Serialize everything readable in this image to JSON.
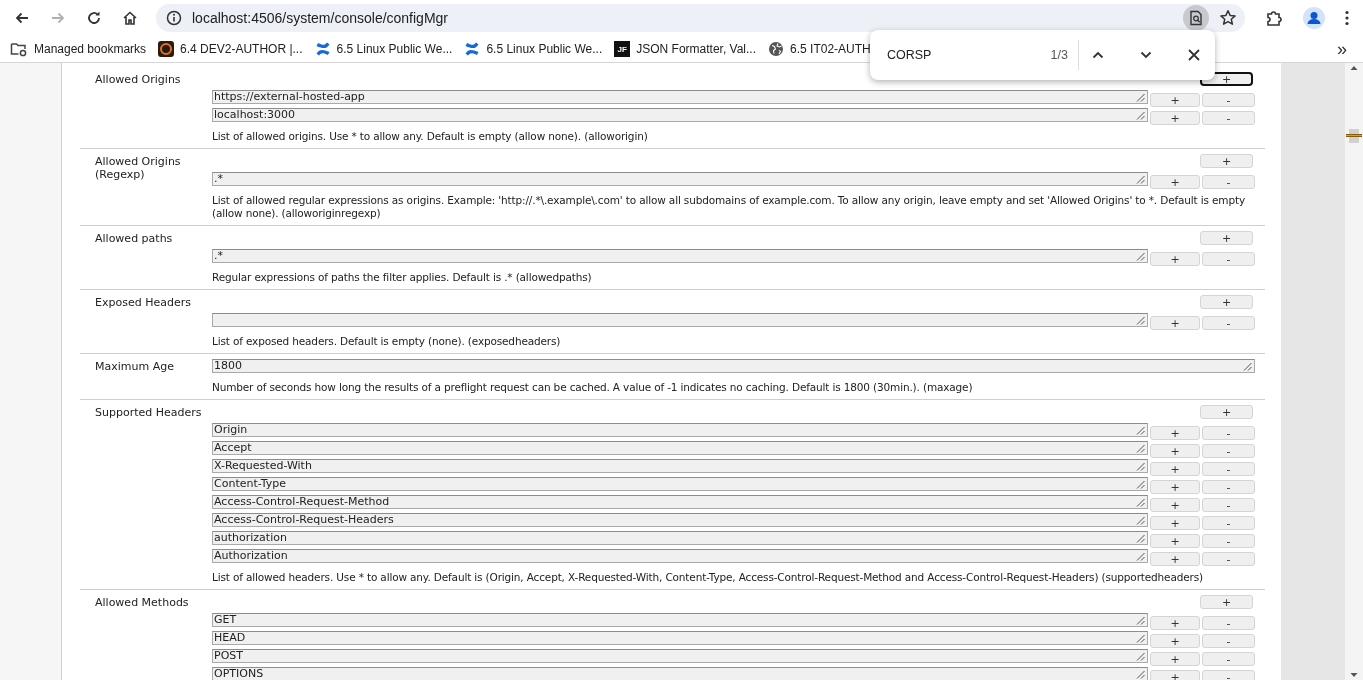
{
  "browser": {
    "forward_disabled": true,
    "address": "localhost:4506/system/console/configMgr",
    "find_active": true,
    "bookmarks": [
      {
        "kind": "folder",
        "label": "Managed bookmarks"
      },
      {
        "kind": "aem",
        "label": "6.4 DEV2-AUTHOR |..."
      },
      {
        "kind": "confluence",
        "label": "6.5 Linux Public We..."
      },
      {
        "kind": "confluence",
        "label": "6.5 Linux Public We..."
      },
      {
        "kind": "badge",
        "badge": "JF",
        "label": "JSON Formatter, Val..."
      },
      {
        "kind": "globe",
        "label": "6.5 IT02-AUTH"
      }
    ],
    "more": "»"
  },
  "find_bar": {
    "query": "CORSP",
    "count": "1/3"
  },
  "sections": [
    {
      "kind": "multi",
      "label": "Allowed Origins",
      "add": {
        "label": "+",
        "focused": true
      },
      "entries": [
        {
          "value": "https://external-hosted-app",
          "add": "+",
          "remove": "-"
        },
        {
          "value": "localhost:3000",
          "add": "+",
          "remove": "-"
        }
      ],
      "description": "List of allowed origins. Use * to allow any. Default is empty (allow none). (alloworigin)"
    },
    {
      "kind": "multi",
      "label": "Allowed Origins (Regexp)",
      "add": {
        "label": "+",
        "focused": false
      },
      "entries": [
        {
          "value": ".*",
          "add": "+",
          "remove": "-"
        }
      ],
      "description": "List of allowed regular expressions as origins. Example: 'http://.*\\.example\\.com' to allow all subdomains of example.com. To allow any origin, leave empty and set 'Allowed Origins' to *. Default is empty (allow none). (alloworiginregexp)"
    },
    {
      "kind": "multi",
      "label": "Allowed paths",
      "add": {
        "label": "+",
        "focused": false
      },
      "entries": [
        {
          "value": ".*",
          "add": "+",
          "remove": "-"
        }
      ],
      "description": "Regular expressions of paths the filter applies. Default is .* (allowedpaths)"
    },
    {
      "kind": "multi",
      "label": "Exposed Headers",
      "add": {
        "label": "+",
        "focused": false
      },
      "entries": [
        {
          "add": "+",
          "remove": "-"
        }
      ],
      "description": "List of exposed headers. Default is empty (none). (exposedheaders)"
    },
    {
      "kind": "single",
      "label": "Maximum Age",
      "value": "1800",
      "description": "Number of seconds how long the results of a preflight request can be cached. A value of -1 indicates no caching. Default is 1800 (30min.). (maxage)"
    },
    {
      "kind": "multi",
      "label": "Supported Headers",
      "add": {
        "label": "+",
        "focused": false
      },
      "entries": [
        {
          "value": "Origin",
          "add": "+",
          "remove": "-"
        },
        {
          "value": "Accept",
          "add": "+",
          "remove": "-"
        },
        {
          "value": "X-Requested-With",
          "add": "+",
          "remove": "-"
        },
        {
          "value": "Content-Type",
          "add": "+",
          "remove": "-"
        },
        {
          "value": "Access-Control-Request-Method",
          "add": "+",
          "remove": "-"
        },
        {
          "value": "Access-Control-Request-Headers",
          "add": "+",
          "remove": "-"
        },
        {
          "value": "authorization",
          "add": "+",
          "remove": "-"
        },
        {
          "value": "Authorization",
          "add": "+",
          "remove": "-"
        }
      ],
      "description": "List of allowed headers. Use * to allow any. Default is (Origin, Accept, X-Requested-With, Content-Type, Access-Control-Request-Method and Access-Control-Request-Headers) (supportedheaders)"
    },
    {
      "kind": "multi",
      "label": "Allowed Methods",
      "add": {
        "label": "+",
        "focused": false
      },
      "entries": [
        {
          "value": "GET",
          "add": "+",
          "remove": "-"
        },
        {
          "value": "HEAD",
          "add": "+",
          "remove": "-"
        },
        {
          "value": "POST",
          "add": "+",
          "remove": "-"
        },
        {
          "value": "OPTIONS",
          "add": "+",
          "remove": "-"
        }
      ]
    }
  ]
}
